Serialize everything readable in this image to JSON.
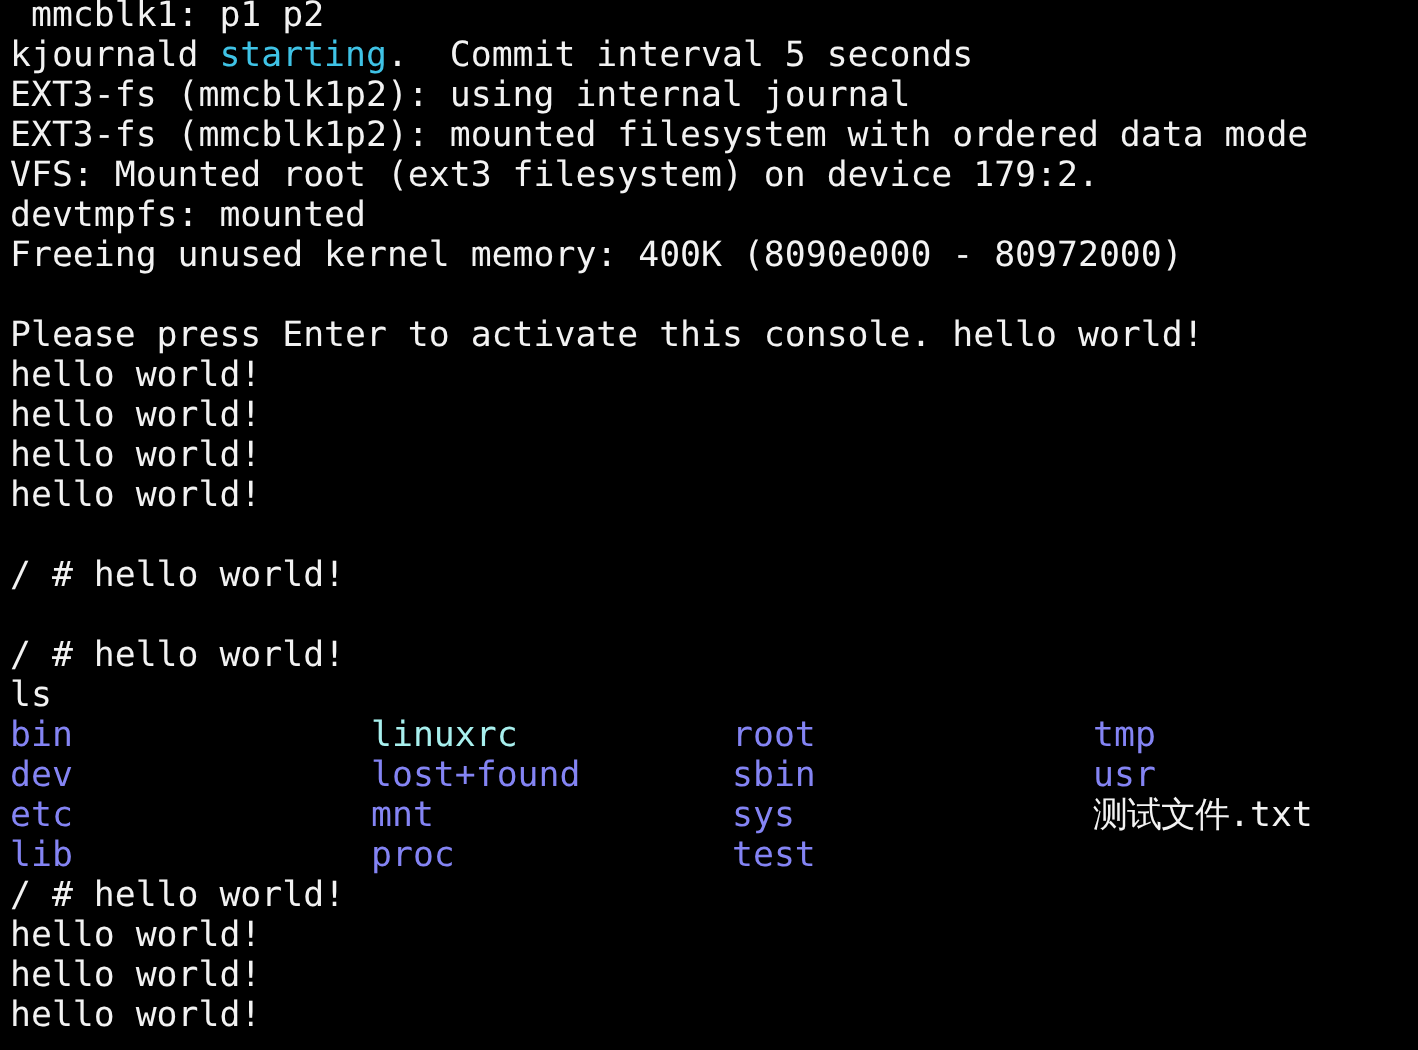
{
  "console": {
    "lines": [
      {
        "kind": "text",
        "segments": [
          {
            "text": " mmcblk1: p1 p2",
            "color": "#f2f2f2"
          }
        ]
      },
      {
        "kind": "text",
        "segments": [
          {
            "text": "kjournald ",
            "color": "#f2f2f2"
          },
          {
            "text": "starting",
            "color": "#3fc3e6"
          },
          {
            "text": ".  Commit interval 5 seconds",
            "color": "#f2f2f2"
          }
        ]
      },
      {
        "kind": "text",
        "segments": [
          {
            "text": "EXT3-fs (mmcblk1p2): using internal journal",
            "color": "#f2f2f2"
          }
        ]
      },
      {
        "kind": "text",
        "segments": [
          {
            "text": "EXT3-fs (mmcblk1p2): mounted filesystem with ordered data mode",
            "color": "#f2f2f2"
          }
        ]
      },
      {
        "kind": "text",
        "segments": [
          {
            "text": "VFS: Mounted root (ext3 filesystem) on device 179:2.",
            "color": "#f2f2f2"
          }
        ]
      },
      {
        "kind": "text",
        "segments": [
          {
            "text": "devtmpfs: mounted",
            "color": "#f2f2f2"
          }
        ]
      },
      {
        "kind": "text",
        "segments": [
          {
            "text": "Freeing unused kernel memory: 400K (8090e000 - 80972000)",
            "color": "#f2f2f2"
          }
        ]
      },
      {
        "kind": "blank"
      },
      {
        "kind": "text",
        "segments": [
          {
            "text": "Please press Enter to activate this console. hello world!",
            "color": "#f2f2f2"
          }
        ]
      },
      {
        "kind": "text",
        "segments": [
          {
            "text": "hello world!",
            "color": "#f2f2f2"
          }
        ]
      },
      {
        "kind": "text",
        "segments": [
          {
            "text": "hello world!",
            "color": "#f2f2f2"
          }
        ]
      },
      {
        "kind": "text",
        "segments": [
          {
            "text": "hello world!",
            "color": "#f2f2f2"
          }
        ]
      },
      {
        "kind": "text",
        "segments": [
          {
            "text": "hello world!",
            "color": "#f2f2f2"
          }
        ]
      },
      {
        "kind": "blank"
      },
      {
        "kind": "text",
        "segments": [
          {
            "text": "/ # hello world!",
            "color": "#f2f2f2"
          }
        ]
      },
      {
        "kind": "blank"
      },
      {
        "kind": "text",
        "segments": [
          {
            "text": "/ # hello world!",
            "color": "#f2f2f2"
          }
        ]
      },
      {
        "kind": "text",
        "segments": [
          {
            "text": "ls",
            "color": "#f2f2f2"
          }
        ]
      },
      {
        "kind": "listing",
        "entries": [
          {
            "name": "bin",
            "color": "#8484f4"
          },
          {
            "name": "linuxrc",
            "color": "#a8f0ee"
          },
          {
            "name": "root",
            "color": "#8484f4"
          },
          {
            "name": "tmp",
            "color": "#8484f4"
          },
          {
            "name": "dev",
            "color": "#8484f4"
          },
          {
            "name": "lost+found",
            "color": "#8484f4"
          },
          {
            "name": "sbin",
            "color": "#8484f4"
          },
          {
            "name": "usr",
            "color": "#8484f4"
          },
          {
            "name": "etc",
            "color": "#8484f4"
          },
          {
            "name": "mnt",
            "color": "#8484f4"
          },
          {
            "name": "sys",
            "color": "#8484f4"
          },
          {
            "name": "测试文件.txt",
            "color": "#f2f2f2"
          },
          {
            "name": "lib",
            "color": "#8484f4"
          },
          {
            "name": "proc",
            "color": "#8484f4"
          },
          {
            "name": "test",
            "color": "#8484f4"
          }
        ]
      },
      {
        "kind": "text",
        "segments": [
          {
            "text": "/ # hello world!",
            "color": "#f2f2f2"
          }
        ]
      },
      {
        "kind": "text",
        "segments": [
          {
            "text": "hello world!",
            "color": "#f2f2f2"
          }
        ]
      },
      {
        "kind": "text",
        "segments": [
          {
            "text": "hello world!",
            "color": "#f2f2f2"
          }
        ]
      },
      {
        "kind": "text",
        "segments": [
          {
            "text": "hello world!",
            "color": "#f2f2f2"
          }
        ]
      }
    ]
  }
}
